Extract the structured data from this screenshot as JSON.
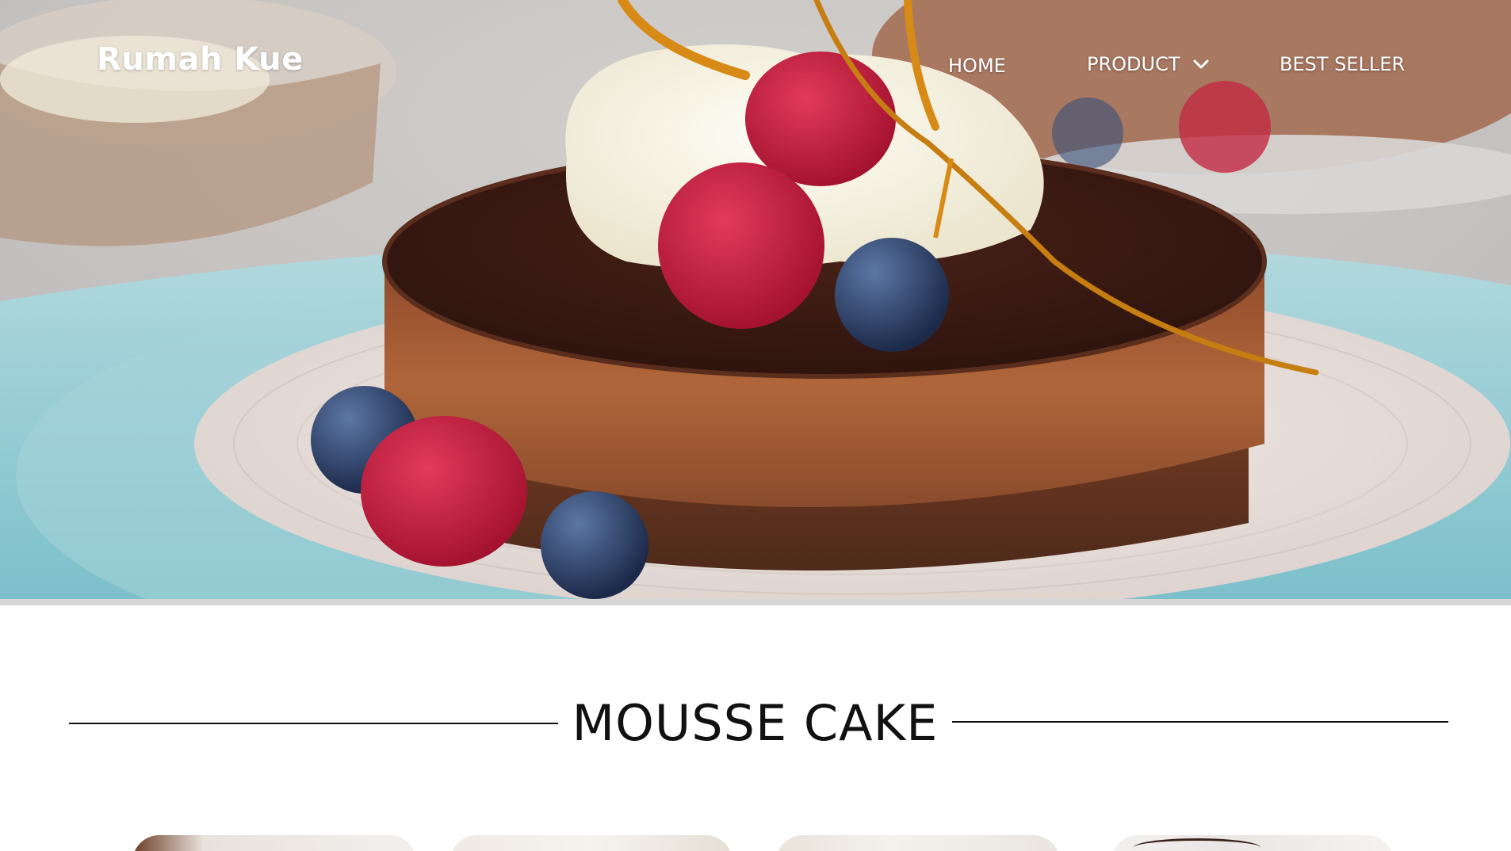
{
  "header": {
    "brand": "Rumah Kue",
    "nav": [
      {
        "label": "HOME",
        "has_dropdown": false
      },
      {
        "label": "PRODUCT",
        "has_dropdown": true,
        "icon": "chevron-down-icon"
      },
      {
        "label": "BEST SELLER",
        "has_dropdown": false
      }
    ]
  },
  "hero": {
    "image": "chocolate mousse cake with cream, raspberries, blueberries and caramel",
    "colors": {
      "cake_top": "#3b1a12",
      "cake_side": "#a4582e",
      "plate": "#e8e0dc",
      "cloth": "#8fc7cf"
    }
  },
  "section": {
    "title": "MOUSSE CAKE"
  },
  "cards": [
    {
      "id": "card-1"
    },
    {
      "id": "card-2"
    },
    {
      "id": "card-3"
    },
    {
      "id": "card-4"
    }
  ]
}
